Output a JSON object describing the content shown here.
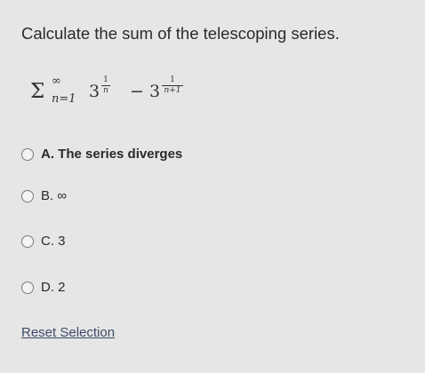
{
  "question": {
    "prompt": "Calculate the sum of the telescoping series."
  },
  "formula": {
    "sigma": "Σ",
    "upper": "∞",
    "lower": "n=1",
    "base": "3",
    "exp1_num": "1",
    "exp1_den": "n",
    "minus": "−",
    "exp2_num": "1",
    "exp2_den": "n+1"
  },
  "options": [
    {
      "letter": "A.",
      "text": "The series diverges"
    },
    {
      "letter": "B.",
      "text": "∞"
    },
    {
      "letter": "C.",
      "text": "3"
    },
    {
      "letter": "D.",
      "text": "2"
    }
  ],
  "reset_label": "Reset Selection"
}
